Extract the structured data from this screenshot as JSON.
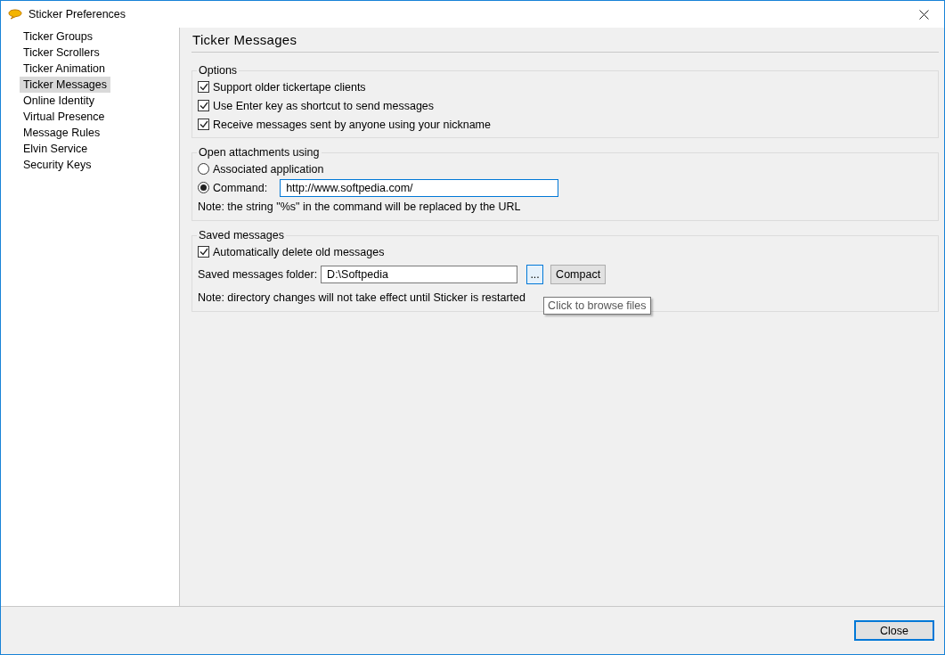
{
  "window": {
    "title": "Sticker Preferences"
  },
  "sidebar": {
    "items": [
      {
        "label": "Ticker Groups",
        "selected": false
      },
      {
        "label": "Ticker Scrollers",
        "selected": false
      },
      {
        "label": "Ticker Animation",
        "selected": false
      },
      {
        "label": "Ticker Messages",
        "selected": true
      },
      {
        "label": "Online Identity",
        "selected": false
      },
      {
        "label": "Virtual Presence",
        "selected": false
      },
      {
        "label": "Message Rules",
        "selected": false
      },
      {
        "label": "Elvin Service",
        "selected": false
      },
      {
        "label": "Security Keys",
        "selected": false
      }
    ]
  },
  "panel": {
    "title": "Ticker Messages"
  },
  "groups": [
    {
      "title": "Options",
      "rows": [
        {
          "kind": "checkbox",
          "label": "Support older tickertape clients",
          "checked": true
        },
        {
          "kind": "checkbox",
          "label": "Use Enter key as shortcut to send messages",
          "checked": true
        },
        {
          "kind": "checkbox",
          "label": "Receive messages sent by anyone using your nickname",
          "checked": true
        }
      ]
    },
    {
      "title": "Open attachments using",
      "rows": [
        {
          "kind": "radio",
          "label": "Associated application",
          "selected": false
        },
        {
          "kind": "radio",
          "label": "Command:",
          "selected": true,
          "value": "http://www.softpedia.com/"
        },
        {
          "kind": "note",
          "text": "Note: the string \"%s\" in the command will be replaced by the URL"
        }
      ]
    },
    {
      "title": "Saved messages",
      "rows": [
        {
          "kind": "checkbox",
          "label": "Automatically delete old messages",
          "checked": true
        },
        {
          "kind": "folder",
          "label": "Saved messages folder:",
          "value": "D:\\Softpedia",
          "browse": "...",
          "button": "Compact",
          "tooltip": "Click to browse files"
        },
        {
          "kind": "note",
          "text": "Note: directory changes will not take effect until Sticker is restarted"
        }
      ]
    }
  ],
  "buttons": [
    {
      "label": "Close"
    }
  ]
}
